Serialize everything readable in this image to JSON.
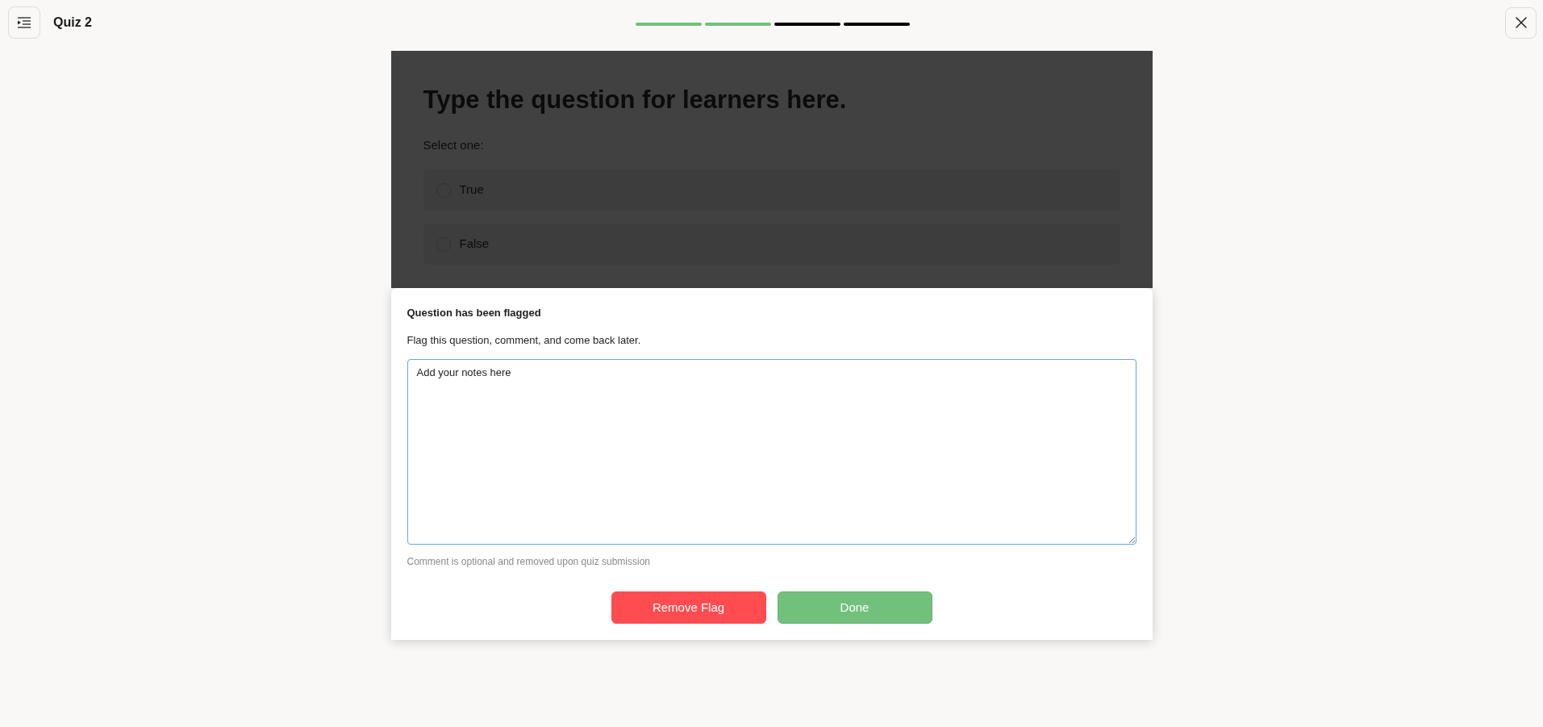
{
  "header": {
    "title": "Quiz 2"
  },
  "progress_segments": [
    {
      "completed": true
    },
    {
      "completed": true
    },
    {
      "completed": false
    },
    {
      "completed": false
    }
  ],
  "question": {
    "title": "Type the question for learners here.",
    "instruction": "Select one:",
    "options": [
      {
        "label": "True",
        "selected": false
      },
      {
        "label": "False",
        "selected": false
      }
    ]
  },
  "flag_dialog": {
    "title": "Question has been flagged",
    "description": "Flag this question, comment, and come back later.",
    "notes": {
      "value": "Add your notes here"
    },
    "hint": "Comment is optional and removed upon quiz submission",
    "buttons": [
      {
        "label": "Remove Flag",
        "kind": "danger"
      },
      {
        "label": "Done",
        "kind": "confirm"
      }
    ]
  }
}
